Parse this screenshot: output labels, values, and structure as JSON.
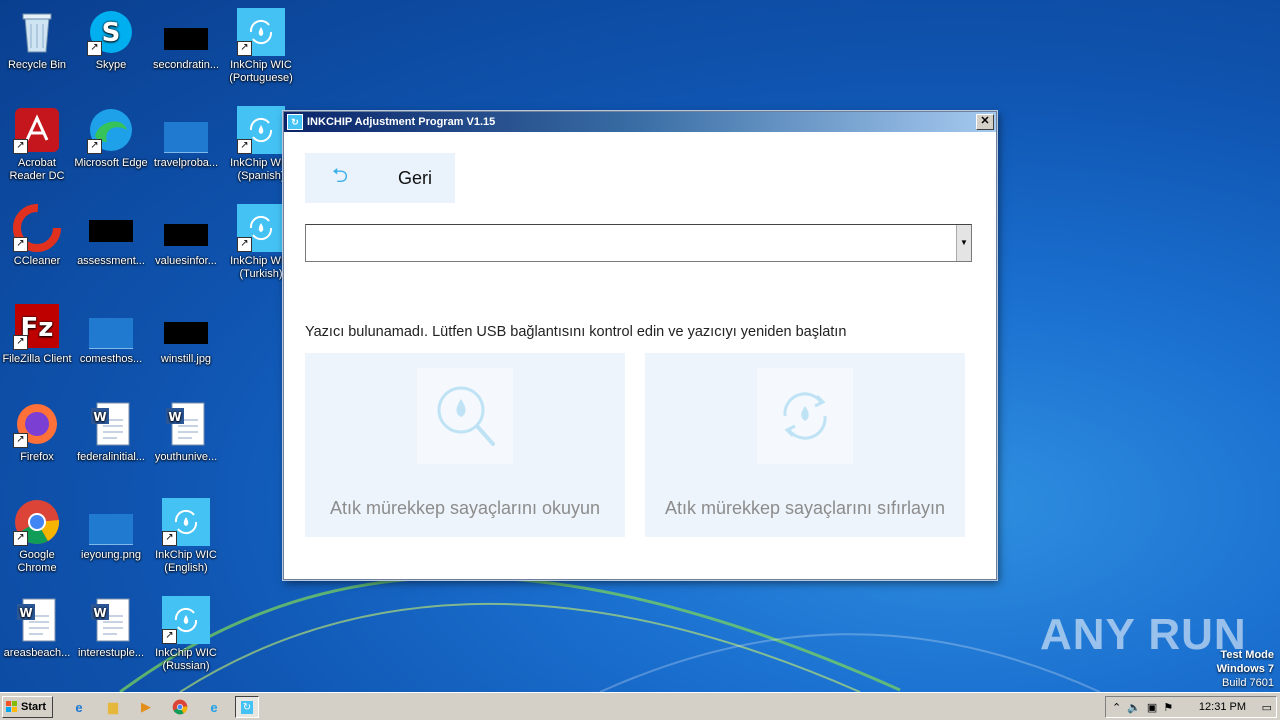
{
  "desktop": {
    "icons": [
      {
        "label": "Recycle Bin"
      },
      {
        "label": "Skype"
      },
      {
        "label": "secondratin..."
      },
      {
        "label": "InkChip WIC (Portuguese)"
      },
      {
        "label": "Acrobat Reader DC"
      },
      {
        "label": "Microsoft Edge"
      },
      {
        "label": "travelproba..."
      },
      {
        "label": "InkChip WIC (Spanish)"
      },
      {
        "label": "CCleaner"
      },
      {
        "label": "assessment..."
      },
      {
        "label": "valuesinfor..."
      },
      {
        "label": "InkChip WIC (Turkish)"
      },
      {
        "label": "FileZilla Client"
      },
      {
        "label": "comesthos..."
      },
      {
        "label": "winstill.jpg"
      },
      {
        "label": "Firefox"
      },
      {
        "label": "federalinitial..."
      },
      {
        "label": "youthunive..."
      },
      {
        "label": "Google Chrome"
      },
      {
        "label": "ieyoung.png"
      },
      {
        "label": "InkChip WIC (English)"
      },
      {
        "label": "areasbeach..."
      },
      {
        "label": "interestuple..."
      },
      {
        "label": "InkChip WIC (Russian)"
      }
    ]
  },
  "window": {
    "title": "INKCHIP Adjustment Program V1.15",
    "close_label": "✕",
    "back_label": "Geri",
    "printer_select_value": "",
    "message": "Yazıcı bulunamadı. Lütfen USB bağlantısını kontrol edin ve yazıcıyı yeniden başlatın",
    "read_card_label": "Atık mürekkep sayaçlarını okuyun",
    "reset_card_label": "Atık mürekkep sayaçlarını sıfırlayın"
  },
  "watermark": {
    "brand": "ANY RUN",
    "test_mode": "Test Mode",
    "os": "Windows 7",
    "build": "Build 7601"
  },
  "taskbar": {
    "start_label": "Start",
    "clock": "12:31 PM"
  },
  "colors": {
    "accent": "#3db0e8",
    "card_bg": "#eef4fb",
    "title_gradient_start": "#0a246a"
  }
}
